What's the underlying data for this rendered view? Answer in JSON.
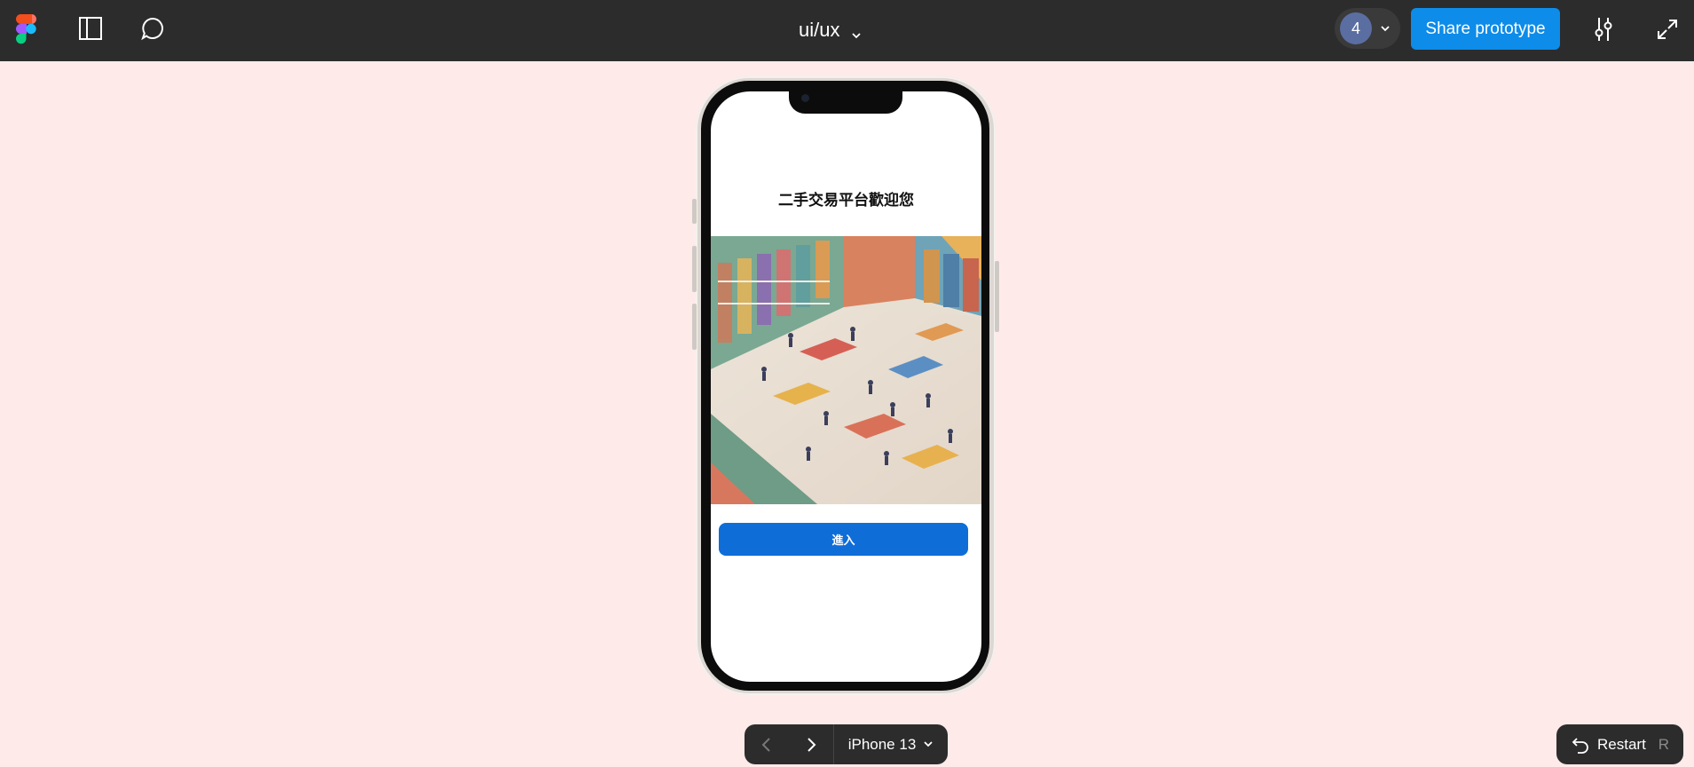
{
  "toolbar": {
    "file_title": "ui/ux",
    "collaborator_count": "4",
    "share_label": "Share prototype"
  },
  "prototype": {
    "welcome_title": "二手交易平台歡迎您",
    "enter_label": "進入",
    "hero_image": "isometric-secondhand-market-illustration"
  },
  "bottom": {
    "device": "iPhone 13",
    "restart_label": "Restart",
    "restart_shortcut": "R"
  },
  "colors": {
    "topbar": "#2c2c2c",
    "canvas": "#ffeaea",
    "share_button": "#0d8ce9",
    "enter_button": "#0f6dd8"
  }
}
